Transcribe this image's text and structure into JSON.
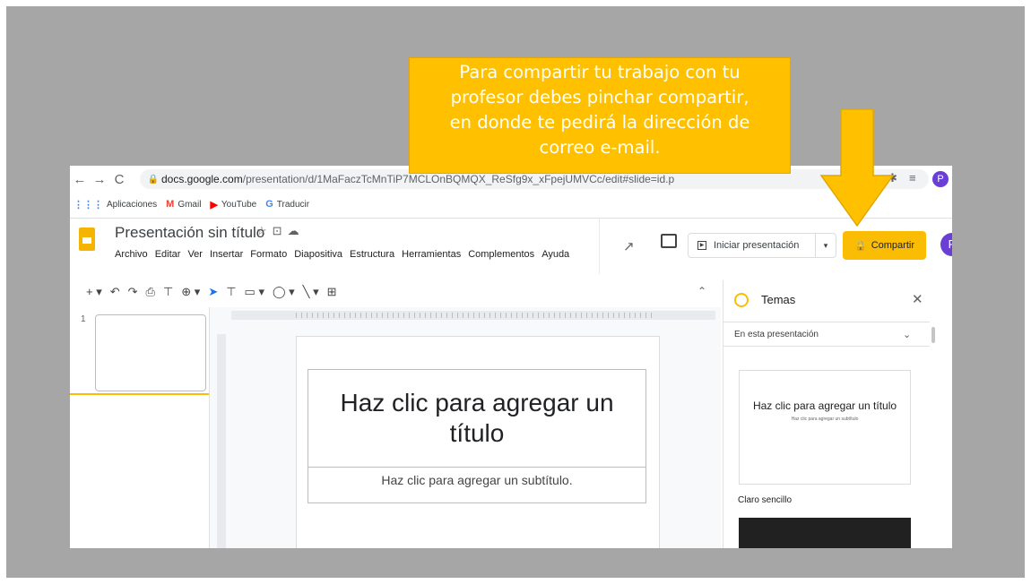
{
  "callout": {
    "lines": [
      "Para compartir tu trabajo con tu",
      "profesor debes pinchar compartir,",
      "en donde te pedirá la dirección de",
      "correo e-mail."
    ]
  },
  "browser": {
    "url_host": "docs.google.com",
    "url_path": "/presentation/d/1MaFaczTcMnTiP7MCLOnBQMQX_ReSfg9x_xFpejUMVCc/edit#slide=id.p",
    "profile_initial": "P",
    "bookmarks": [
      "Aplicaciones",
      "Gmail",
      "YouTube",
      "Traducir"
    ]
  },
  "docs": {
    "title": "Presentación sin título",
    "menu": [
      "Archivo",
      "Editar",
      "Ver",
      "Insertar",
      "Formato",
      "Diapositiva",
      "Estructura",
      "Herramientas",
      "Complementos",
      "Ayuda"
    ],
    "present_label": "Iniciar presentación",
    "share_label": "Compartir",
    "avatar_initial": "P"
  },
  "filmstrip": {
    "slide_number": "1"
  },
  "slide": {
    "title_placeholder": "Haz clic para agregar un título",
    "subtitle_placeholder": "Haz clic para agregar un subtítulo."
  },
  "themes": {
    "title": "Temas",
    "section": "En esta presentación",
    "card_title": "Haz clic para agregar un título",
    "card_subtitle": "Haz clic para agregar un subtítulo",
    "theme_name": "Claro sencillo"
  },
  "colors": {
    "callout": "#ffc000",
    "share": "#fbbc04",
    "background": "#a6a6a6",
    "avatar": "#6a3fd6"
  }
}
